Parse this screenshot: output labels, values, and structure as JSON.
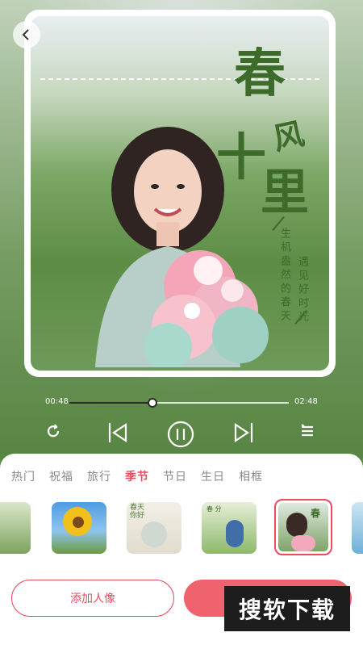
{
  "card": {
    "title_chars": [
      "春",
      "十",
      "风",
      "里"
    ],
    "subtitle_col1": "生机盎然的春天",
    "subtitle_col2": "遇见好时光"
  },
  "player": {
    "current_time": "00:48",
    "total_time": "02:48",
    "progress": 0.38
  },
  "tabs": [
    {
      "label": "热门"
    },
    {
      "label": "祝福"
    },
    {
      "label": "旅行"
    },
    {
      "label": "季节",
      "active": true
    },
    {
      "label": "节日"
    },
    {
      "label": "生日"
    },
    {
      "label": "相框"
    }
  ],
  "thumbnails": {
    "t2_text": "春天\n你好",
    "t3_text": "春 分"
  },
  "buttons": {
    "add_portrait": "添加人像"
  },
  "watermark": "搜软下载",
  "colors": {
    "accent": "#ec4a5e",
    "title_green": "#3d6b2a"
  }
}
